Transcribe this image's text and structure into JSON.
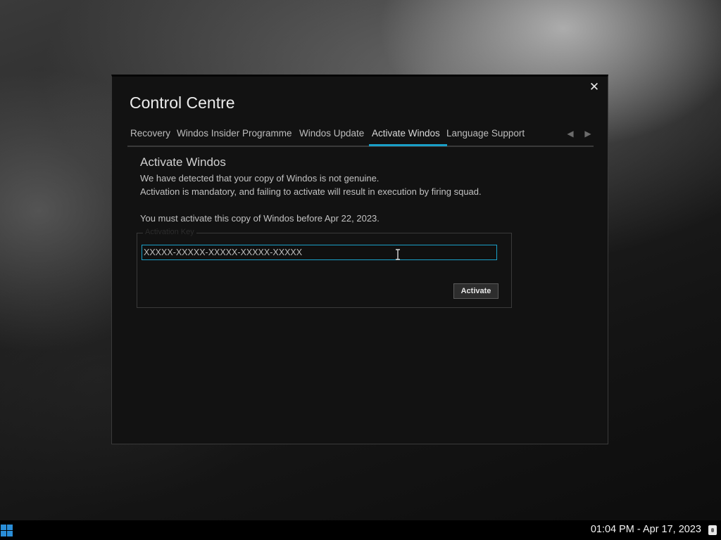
{
  "window": {
    "title": "Control Centre",
    "close_glyph": "✕"
  },
  "tabs": [
    {
      "label": "Recovery",
      "active": false
    },
    {
      "label": "Windos Insider Programme",
      "active": false
    },
    {
      "label": "Windos Update",
      "active": false
    },
    {
      "label": "Activate Windos",
      "active": true
    },
    {
      "label": "Language Support",
      "active": false
    }
  ],
  "tab_nav": {
    "prev_glyph": "◀",
    "next_glyph": "▶"
  },
  "activation": {
    "heading": "Activate Windos",
    "line1": "We have detected that your copy of Windos is not genuine.",
    "line2": "Activation is mandatory, and failing to activate will result in execution by firing squad.",
    "deadline": "You must activate this copy of Windos before Apr 22, 2023.",
    "key_group_label": "Activation Key",
    "key_value": "XXXXX-XXXXX-XXXXX-XXXXX-XXXXX",
    "activate_label": "Activate"
  },
  "taskbar": {
    "clock": "01:04 PM - Apr 17, 2023",
    "start_icon": "windows-logo-icon",
    "notification_icon": "notification-icon"
  },
  "colors": {
    "accent": "#1aa0c8",
    "window_bg": "#121212",
    "start_blue": "#2a8ed8"
  }
}
